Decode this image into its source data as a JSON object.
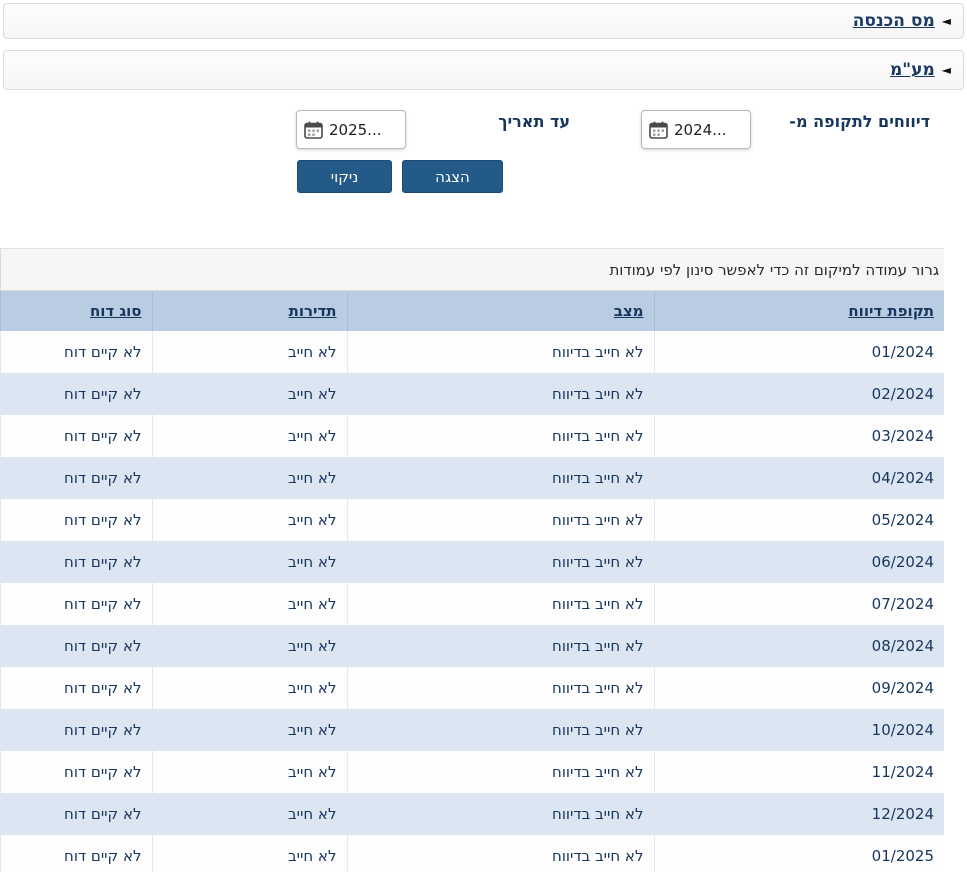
{
  "sections": {
    "income_tax": {
      "label": "מס הכנסה"
    },
    "vat": {
      "label": "מע\"מ"
    }
  },
  "filter": {
    "from_label": "דיווחים לתקופה מ-",
    "from_value": "2024...",
    "to_label": "עד תאריך",
    "to_value": "2025...",
    "show_button": "הצגה",
    "clear_button": "ניקוי"
  },
  "table": {
    "group_hint": "גרור עמודה למיקום זה כדי לאפשר סינון לפי עמודות",
    "columns": [
      "תקופת דיווח",
      "מצב",
      "תדירות",
      "סוג דוח"
    ],
    "rows": [
      {
        "period": "01/2024",
        "status": "לא חייב בדיווח",
        "frequency": "לא חייב",
        "report_type": "לא קיים דוח"
      },
      {
        "period": "02/2024",
        "status": "לא חייב בדיווח",
        "frequency": "לא חייב",
        "report_type": "לא קיים דוח"
      },
      {
        "period": "03/2024",
        "status": "לא חייב בדיווח",
        "frequency": "לא חייב",
        "report_type": "לא קיים דוח"
      },
      {
        "period": "04/2024",
        "status": "לא חייב בדיווח",
        "frequency": "לא חייב",
        "report_type": "לא קיים דוח"
      },
      {
        "period": "05/2024",
        "status": "לא חייב בדיווח",
        "frequency": "לא חייב",
        "report_type": "לא קיים דוח"
      },
      {
        "period": "06/2024",
        "status": "לא חייב בדיווח",
        "frequency": "לא חייב",
        "report_type": "לא קיים דוח"
      },
      {
        "period": "07/2024",
        "status": "לא חייב בדיווח",
        "frequency": "לא חייב",
        "report_type": "לא קיים דוח"
      },
      {
        "period": "08/2024",
        "status": "לא חייב בדיווח",
        "frequency": "לא חייב",
        "report_type": "לא קיים דוח"
      },
      {
        "period": "09/2024",
        "status": "לא חייב בדיווח",
        "frequency": "לא חייב",
        "report_type": "לא קיים דוח"
      },
      {
        "period": "10/2024",
        "status": "לא חייב בדיווח",
        "frequency": "לא חייב",
        "report_type": "לא קיים דוח"
      },
      {
        "period": "11/2024",
        "status": "לא חייב בדיווח",
        "frequency": "לא חייב",
        "report_type": "לא קיים דוח"
      },
      {
        "period": "12/2024",
        "status": "לא חייב בדיווח",
        "frequency": "לא חייב",
        "report_type": "לא קיים דוח"
      },
      {
        "period": "01/2025",
        "status": "לא חייב בדיווח",
        "frequency": "לא חייב",
        "report_type": "לא קיים דוח"
      }
    ]
  },
  "colors": {
    "button_bg": "#235a87",
    "table_header_bg": "#b9cce2",
    "row_alt_bg": "#dce6f2",
    "text_navy": "#17365d"
  }
}
